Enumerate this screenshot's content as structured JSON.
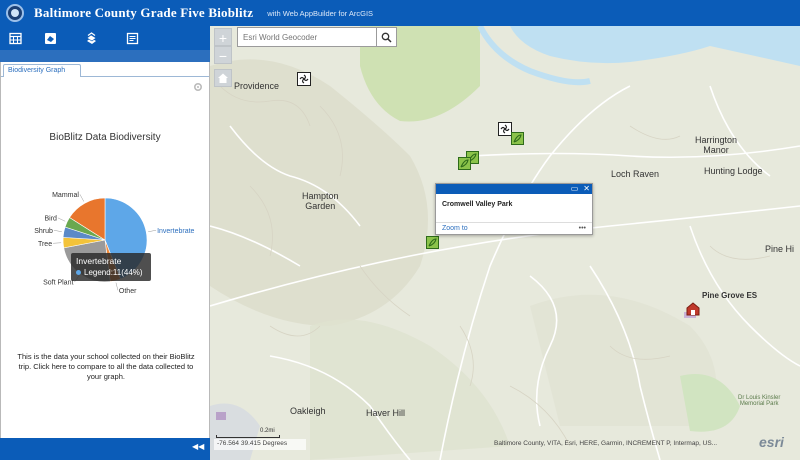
{
  "header": {
    "title": "Baltimore County Grade Five Bioblitz",
    "subtitle": "with Web AppBuilder for ArcGIS"
  },
  "toolbar": {
    "items": [
      {
        "icon": "table-icon"
      },
      {
        "icon": "layers-icon"
      },
      {
        "icon": "legend-icon"
      },
      {
        "icon": "edit-icon"
      }
    ]
  },
  "panel": {
    "tab_label": "Biodiversity Graph",
    "chart_title": "BioBlitz Data Biodiversity",
    "description": "This is the data your school collected on their BioBlitz trip.  Click here to compare to all the data collected to your graph.",
    "tooltip": {
      "title": "Invertebrate",
      "value": "Legend:11(44%)"
    }
  },
  "chart_data": {
    "type": "pie",
    "title": "BioBlitz Data Biodiversity",
    "slices": [
      {
        "label": "Invertebrate",
        "value": 44,
        "color": "#5ea7e8"
      },
      {
        "label": "Other",
        "value": 4,
        "color": "#f08a3a"
      },
      {
        "label": "Soft Plant",
        "value": 24,
        "color": "#9a9a9a"
      },
      {
        "label": "Tree",
        "value": 4,
        "color": "#f3c33a"
      },
      {
        "label": "Shrub",
        "value": 4,
        "color": "#5b8ac8"
      },
      {
        "label": "Bird",
        "value": 4,
        "color": "#6aa84f"
      },
      {
        "label": "Mammal",
        "value": 16,
        "color": "#e8762d"
      }
    ]
  },
  "map": {
    "search": {
      "placeholder": "Esri World Geocoder"
    },
    "zoom_in": "+",
    "zoom_out": "−",
    "popup": {
      "title": "Cromwell Valley Park",
      "zoom_label": "Zoom to",
      "more": "•••"
    },
    "places": [
      {
        "name": "Providence"
      },
      {
        "name": "Hampton\nGarden"
      },
      {
        "name": "Harrington\nManor"
      },
      {
        "name": "Loch Raven"
      },
      {
        "name": "Hunting Lodge"
      },
      {
        "name": "Pine Hi"
      },
      {
        "name": "Pine Grove ES"
      },
      {
        "name": "Oakleigh"
      },
      {
        "name": "Haver Hill"
      },
      {
        "name": "Dr Louis Kinsler\nMemorial Park"
      }
    ],
    "scale_label": "0.2mi",
    "coordinates": "-76.564 39.415 Degrees",
    "attribution": "Baltimore County, VITA, Esri, HERE, Garmin, INCREMENT P, Intermap, US...",
    "esri_logo": "esri"
  }
}
